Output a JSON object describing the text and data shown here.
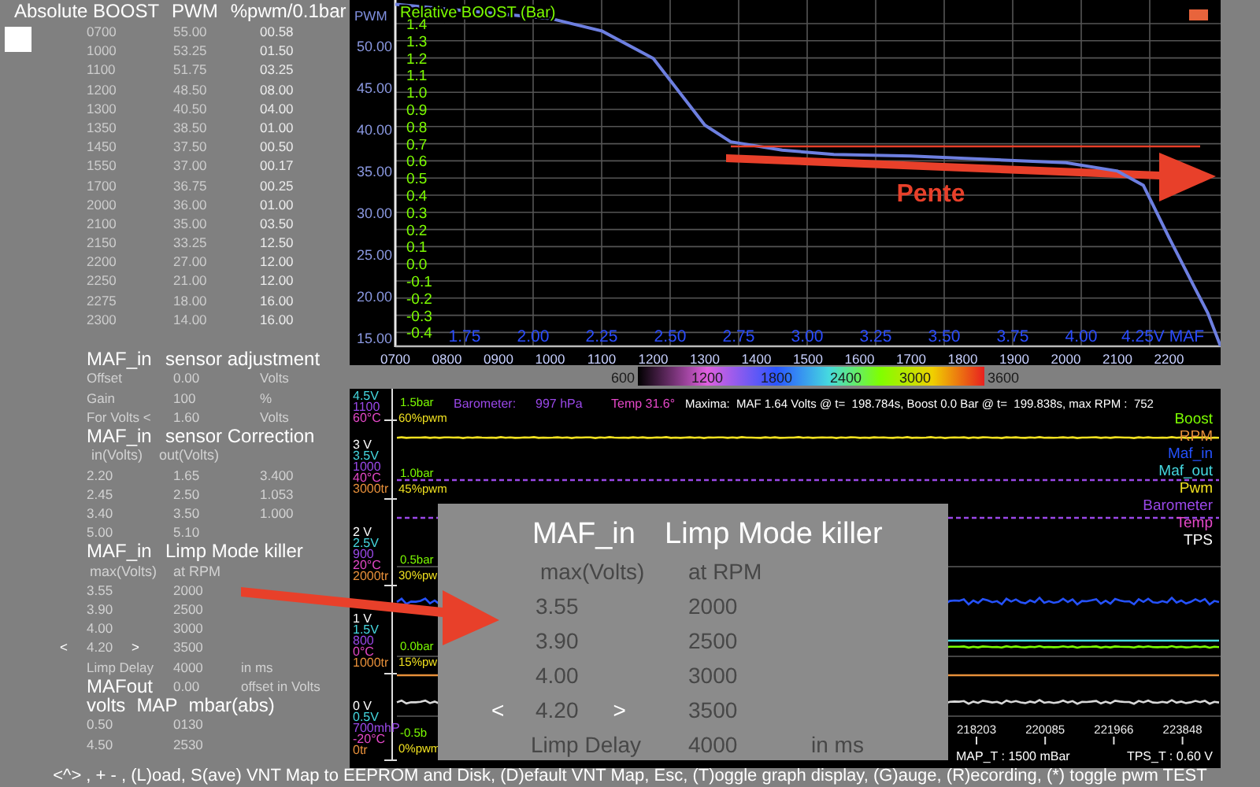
{
  "boost_table": {
    "headers": [
      "Absolute BOOST",
      "PWM",
      "%pwm/0.1bar"
    ],
    "rows": [
      {
        "rpm": "0700",
        "pwm": "55.00",
        "pct": "00.58"
      },
      {
        "rpm": "1000",
        "pwm": "53.25",
        "pct": "01.50"
      },
      {
        "rpm": "1100",
        "pwm": "51.75",
        "pct": "03.25"
      },
      {
        "rpm": "1200",
        "pwm": "48.50",
        "pct": "08.00"
      },
      {
        "rpm": "1300",
        "pwm": "40.50",
        "pct": "04.00"
      },
      {
        "rpm": "1350",
        "pwm": "38.50",
        "pct": "01.00"
      },
      {
        "rpm": "1450",
        "pwm": "37.50",
        "pct": "00.50"
      },
      {
        "rpm": "1550",
        "pwm": "37.00",
        "pct": "00.17"
      },
      {
        "rpm": "1700",
        "pwm": "36.75",
        "pct": "00.25"
      },
      {
        "rpm": "2000",
        "pwm": "36.00",
        "pct": "01.00"
      },
      {
        "rpm": "2100",
        "pwm": "35.00",
        "pct": "03.50"
      },
      {
        "rpm": "2150",
        "pwm": "33.25",
        "pct": "12.50"
      },
      {
        "rpm": "2200",
        "pwm": "27.00",
        "pct": "12.00"
      },
      {
        "rpm": "2250",
        "pwm": "21.00",
        "pct": "12.00"
      },
      {
        "rpm": "2275",
        "pwm": "18.00",
        "pct": "16.00"
      },
      {
        "rpm": "2300",
        "pwm": "14.00",
        "pct": "16.00"
      }
    ]
  },
  "maf_adjustment": {
    "title_var": "MAF_in",
    "title": "sensor adjustment",
    "rows": [
      [
        "Offset",
        "0.00",
        "Volts"
      ],
      [
        "Gain",
        "100",
        "%"
      ],
      [
        "For Volts <",
        "1.60",
        "Volts"
      ]
    ]
  },
  "maf_correction": {
    "title_var": "MAF_in",
    "title": "sensor Correction",
    "headers": [
      "in(Volts)",
      "out(Volts)"
    ],
    "rows": [
      [
        "2.20",
        "1.65",
        "3.400"
      ],
      [
        "2.45",
        "2.50",
        "1.053"
      ],
      [
        "3.40",
        "3.50",
        "1.000"
      ],
      [
        "5.00",
        "5.10"
      ]
    ]
  },
  "limp_killer": {
    "title_var": "MAF_in",
    "title": "Limp Mode killer",
    "headers": [
      "max(Volts)",
      "at RPM"
    ],
    "prev": "<",
    "next": ">",
    "rows": [
      {
        "volts": "3.55",
        "rpm": "2000",
        "selected": false
      },
      {
        "volts": "3.90",
        "rpm": "2500",
        "selected": false
      },
      {
        "volts": "4.00",
        "rpm": "3000",
        "selected": false
      },
      {
        "volts": "4.20",
        "rpm": "3500",
        "selected": true
      }
    ],
    "delay": [
      "Limp Delay",
      "4000",
      "in ms"
    ]
  },
  "maf_out": [
    "MAFout",
    "0.00",
    "offset in Volts"
  ],
  "map_table": {
    "headers": [
      "volts",
      "MAP",
      "mbar(abs)"
    ],
    "rows": [
      [
        "0.50",
        "0130"
      ],
      [
        "4.50",
        "2530"
      ]
    ]
  },
  "top_chart": {
    "chart_data": {
      "type": "line",
      "grid": true,
      "x": [
        700,
        1000,
        1100,
        1200,
        1300,
        1350,
        1450,
        1550,
        1700,
        2000,
        2100,
        2150,
        2200,
        2250,
        2275,
        2300
      ],
      "series": [
        {
          "name": "PWM",
          "color": "#6d7fe0",
          "values": [
            55,
            53.3,
            51.8,
            48.5,
            40.5,
            38.5,
            37.5,
            37,
            36.8,
            36,
            35,
            33.3,
            27,
            21,
            18,
            14
          ]
        }
      ],
      "xlim": [
        700,
        2300
      ],
      "ylim": [
        14,
        55.5
      ],
      "xticks": [
        {
          "value": 700,
          "label": "0700"
        },
        {
          "value": 800,
          "label": "0800"
        },
        {
          "value": 900,
          "label": "0900"
        },
        {
          "value": 1000,
          "label": "1000"
        },
        {
          "value": 1100,
          "label": "1100"
        },
        {
          "value": 1200,
          "label": "1200"
        },
        {
          "value": 1300,
          "label": "1300"
        },
        {
          "value": 1400,
          "label": "1400"
        },
        {
          "value": 1500,
          "label": "1500"
        },
        {
          "value": 1600,
          "label": "1600"
        },
        {
          "value": 1700,
          "label": "1700"
        },
        {
          "value": 1800,
          "label": "1800"
        },
        {
          "value": 1900,
          "label": "1900"
        },
        {
          "value": 2000,
          "label": "2000"
        },
        {
          "value": 2100,
          "label": "2100"
        },
        {
          "value": 2200,
          "label": "2200"
        }
      ],
      "yticks": [
        {
          "value": 15,
          "label": "15.00"
        },
        {
          "value": 20,
          "label": "20.00"
        },
        {
          "value": 25,
          "label": "25.00"
        },
        {
          "value": 30,
          "label": "30.00"
        },
        {
          "value": 35,
          "label": "35.00"
        },
        {
          "value": 40,
          "label": "40.00"
        },
        {
          "value": 45,
          "label": "45.00"
        },
        {
          "value": 50,
          "label": "50.00"
        }
      ]
    },
    "boost_axis": {
      "title": "Relative BOOST (Bar)",
      "labels": [
        "1.4",
        "1.3",
        "1.2",
        "1.1",
        "1.0",
        "0.9",
        "0.8",
        "0.7",
        "0.6",
        "0.5",
        "0.4",
        "0.3",
        "0.2",
        "0.1",
        "0.0",
        "-0.1",
        "-0.2",
        "-0.3",
        "-0.4"
      ]
    },
    "maf_axis": {
      "labels": [
        "1.75",
        "2.00",
        "2.25",
        "2.50",
        "2.75",
        "3.00",
        "3.25",
        "3.50",
        "3.75",
        "4.00",
        "4.25V MAF"
      ]
    },
    "annotation": "Pente"
  },
  "rpm_colorbar": {
    "labels": [
      "600",
      "1200",
      "1800",
      "2400",
      "3000",
      "3600"
    ]
  },
  "live_graph": {
    "header": [
      {
        "text": "Barometer:",
        "kind": "baro"
      },
      {
        "text": "997 hPa",
        "kind": "baro"
      },
      {
        "text": "Temp 31.6°",
        "kind": "temp"
      },
      {
        "text": "Maxima:  MAF 1.64 Volts @ t=  198.784s, Boost 0.0 Bar @ t=  199.838s, max RPM :  752",
        "kind": "tps"
      }
    ],
    "scale_groups": [
      {
        "items": [
          {
            "text": "4.5V",
            "kind": "maf_out"
          },
          {
            "text": "1100",
            "kind": "baro"
          },
          {
            "text": "60°C",
            "kind": "temp"
          }
        ]
      },
      {
        "items": [
          {
            "text": "3 V",
            "kind": "tps"
          },
          {
            "text": "3.5V",
            "kind": "maf_out"
          },
          {
            "text": "1000",
            "kind": "baro"
          },
          {
            "text": "40°C",
            "kind": "temp"
          },
          {
            "text": "3000tr",
            "kind": "rpm"
          }
        ]
      },
      {
        "items": [
          {
            "text": "2 V",
            "kind": "tps"
          },
          {
            "text": "2.5V",
            "kind": "maf_out"
          },
          {
            "text": "900",
            "kind": "baro"
          },
          {
            "text": "20°C",
            "kind": "temp"
          },
          {
            "text": "2000tr",
            "kind": "rpm"
          }
        ]
      },
      {
        "items": [
          {
            "text": "1 V",
            "kind": "tps"
          },
          {
            "text": "1.5V",
            "kind": "maf_out"
          },
          {
            "text": "800",
            "kind": "baro"
          },
          {
            "text": "0°C",
            "kind": "temp"
          },
          {
            "text": "1000tr",
            "kind": "rpm"
          }
        ]
      },
      {
        "items": [
          {
            "text": "0 V",
            "kind": "tps"
          },
          {
            "text": "0.5V",
            "kind": "maf_out"
          },
          {
            "text": "700mhP",
            "kind": "baro"
          },
          {
            "text": "-20°C",
            "kind": "temp"
          },
          {
            "text": "0tr",
            "kind": "rpm"
          }
        ]
      }
    ],
    "boost_scale": [
      {
        "bar": "1.5bar",
        "pwm": "60%pwm"
      },
      {
        "bar": "1.0bar",
        "pwm": "45%pwm"
      },
      {
        "bar": "0.5bar",
        "pwm": "30%pw"
      },
      {
        "bar": "0.0bar",
        "pwm": "15%pw"
      },
      {
        "bar": "-0.5b",
        "pwm": "0%pwm"
      }
    ],
    "legend": [
      {
        "text": "Boost",
        "kind": "boost"
      },
      {
        "text": "RPM",
        "kind": "rpm"
      },
      {
        "text": "Maf_in",
        "kind": "maf_in"
      },
      {
        "text": "Maf_out",
        "kind": "maf_out"
      },
      {
        "text": "Pwm",
        "kind": "pwm"
      },
      {
        "text": "Barometer",
        "kind": "baro"
      },
      {
        "text": "Temp",
        "kind": "temp"
      },
      {
        "text": "TPS",
        "kind": "tps"
      }
    ],
    "time_ticks": [
      "218203",
      "220085",
      "221966",
      "223848"
    ],
    "readouts": [
      "MAP_T : 1500 mBar",
      "TPS_T : 0.60 V"
    ]
  },
  "limp_popup": {
    "title_var": "MAF_in",
    "title": "Limp Mode killer",
    "headers": [
      "max(Volts)",
      "at RPM"
    ],
    "prev": "<",
    "next": ">",
    "rows": [
      {
        "volts": "3.55",
        "rpm": "2000",
        "selected": false
      },
      {
        "volts": "3.90",
        "rpm": "2500",
        "selected": false
      },
      {
        "volts": "4.00",
        "rpm": "3000",
        "selected": false
      },
      {
        "volts": "4.20",
        "rpm": "3500",
        "selected": true
      }
    ],
    "delay": [
      "Limp Delay",
      "4000",
      "in ms"
    ]
  },
  "help_line": "<^> , + - , (L)oad, S(ave) VNT Map to EEPROM and Disk, (D)efault VNT Map, Esc, (T)oggle graph display, (G)auge, (R)ecording, (*) toggle pwm TEST"
}
